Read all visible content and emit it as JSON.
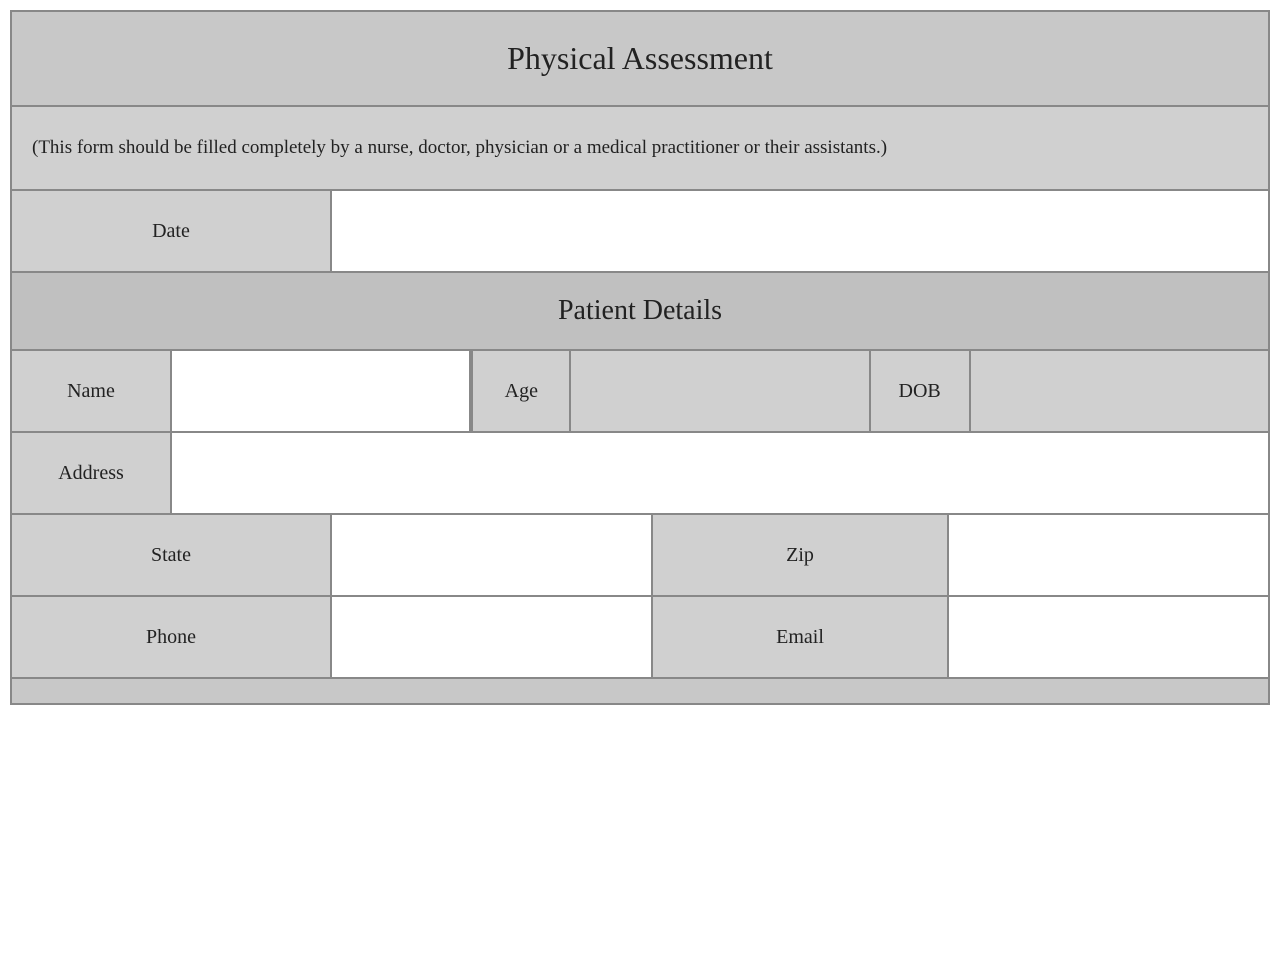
{
  "form": {
    "title": "Physical Assessment",
    "description": "(This form should be filled completely by a nurse, doctor, physician or a medical practitioner or their assistants.)",
    "date_label": "Date",
    "date_value": "",
    "patient_details_header": "Patient Details",
    "name_label": "Name",
    "name_value": "",
    "age_label": "Age",
    "age_value": "",
    "dob_label": "DOB",
    "dob_value": "",
    "address_label": "Address",
    "address_value": "",
    "state_label": "State",
    "state_value": "",
    "zip_label": "Zip",
    "zip_value": "",
    "phone_label": "Phone",
    "phone_value": "",
    "email_label": "Email",
    "email_value": ""
  }
}
